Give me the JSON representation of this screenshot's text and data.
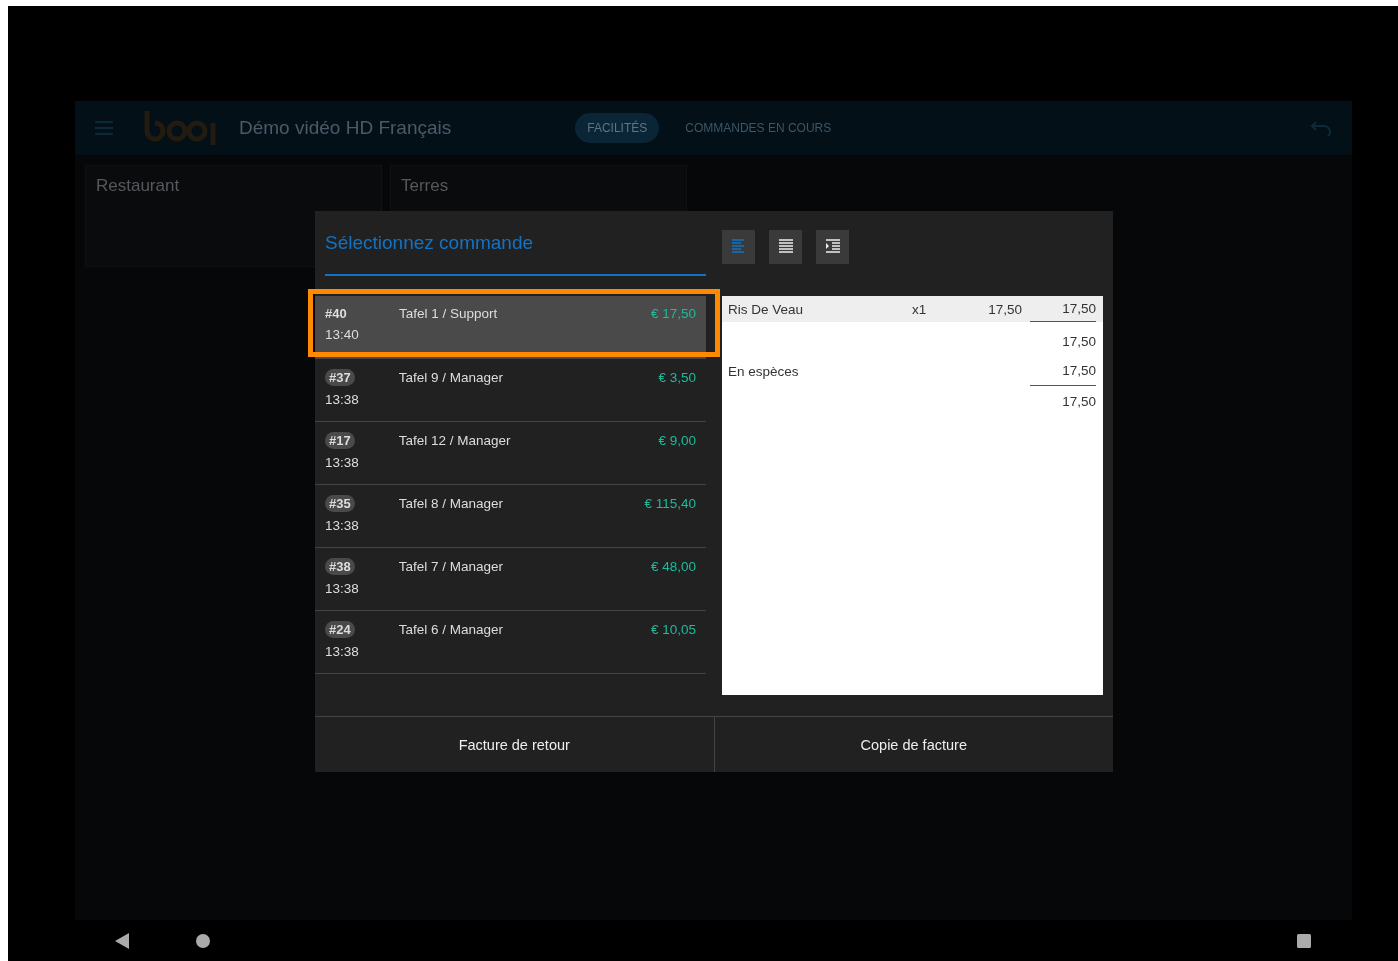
{
  "app_bar": {
    "title": "Démo vidéo HD Français",
    "tabs": [
      {
        "label": "FACILITÉS",
        "selected": true
      },
      {
        "label": "COMMANDES EN COURS",
        "selected": false
      }
    ]
  },
  "areas": [
    "Restaurant",
    "Terres"
  ],
  "dialog": {
    "title": "Sélectionnez commande",
    "view_buttons": [
      {
        "selected": true
      },
      {
        "selected": false
      },
      {
        "selected": false
      }
    ],
    "orders": [
      {
        "number": "#40",
        "table": "Tafel 1 / Support",
        "amount": "€ 17,50",
        "time": "13:40",
        "selected": true,
        "highlighted": true
      },
      {
        "number": "#37",
        "table": "Tafel 9 / Manager",
        "amount": "€ 3,50",
        "time": "13:38",
        "selected": false,
        "highlighted": false
      },
      {
        "number": "#17",
        "table": "Tafel 12 / Manager",
        "amount": "€ 9,00",
        "time": "13:38",
        "selected": false,
        "highlighted": false
      },
      {
        "number": "#35",
        "table": "Tafel 8 / Manager",
        "amount": "€ 115,40",
        "time": "13:38",
        "selected": false,
        "highlighted": false
      },
      {
        "number": "#38",
        "table": "Tafel 7 / Manager",
        "amount": "€ 48,00",
        "time": "13:38",
        "selected": false,
        "highlighted": false
      },
      {
        "number": "#24",
        "table": "Tafel 6 / Manager",
        "amount": "€ 10,05",
        "time": "13:38",
        "selected": false,
        "highlighted": false
      }
    ],
    "receipt": [
      {
        "kind": "item",
        "name": "Ris De Veau",
        "qty": "x1",
        "price": "17,50",
        "total": "17,50"
      },
      {
        "kind": "subtotal",
        "total": "17,50"
      },
      {
        "kind": "payment",
        "name": "En espèces",
        "total": "17,50"
      },
      {
        "kind": "total",
        "total": "17,50"
      }
    ],
    "buttons": [
      "Facture de retour",
      "Copie de facture"
    ]
  }
}
